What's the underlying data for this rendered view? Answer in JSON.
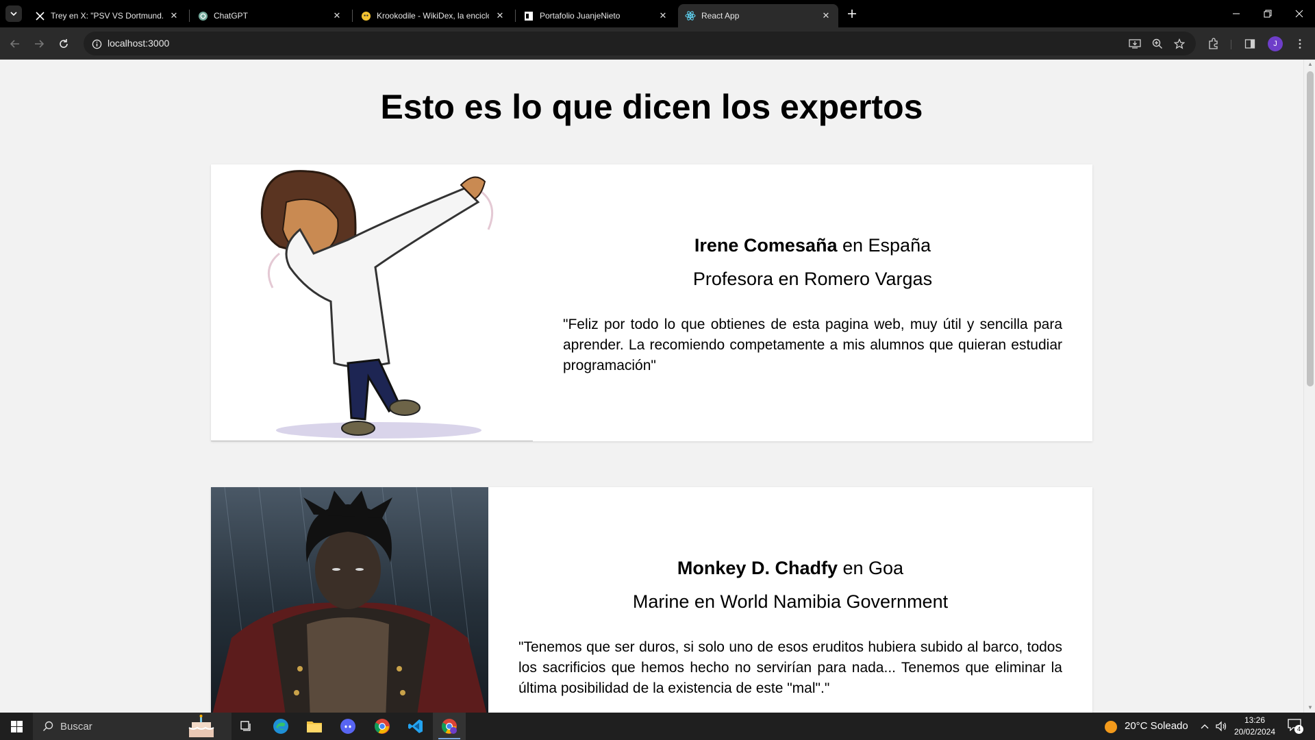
{
  "browser": {
    "tabs": [
      {
        "title": "Trey en X: \"PSV VS Dortmund. Ir",
        "icon": "x-logo-icon"
      },
      {
        "title": "ChatGPT",
        "icon": "chatgpt-icon"
      },
      {
        "title": "Krookodile - WikiDex, la enciclo",
        "icon": "wikidex-icon"
      },
      {
        "title": "Portafolio JuanjeNieto",
        "icon": "page-icon"
      },
      {
        "title": "React App",
        "icon": "react-icon"
      }
    ],
    "url": "localhost:3000"
  },
  "page": {
    "title": "Esto es lo que dicen los expertos",
    "testimonials": [
      {
        "name": "Irene Comesaña",
        "connector": " en ",
        "location": "España",
        "role": "Profesora en Romero Vargas",
        "quote": "\"Feliz por todo lo que obtienes de esta pagina web, muy útil y sencilla para aprender. La recomiendo competamente a mis alumnos que quieran estudiar programación\""
      },
      {
        "name": "Monkey D. Chadfy",
        "connector": " en ",
        "location": "Goa",
        "role": "Marine en World Namibia Government",
        "quote": "\"Tenemos que ser duros, si solo uno de esos eruditos hubiera subido al barco, todos los sacrificios que hemos hecho no servirían para nada... Tenemos que eliminar la última posibilidad de la existencia de este \"mal\".\""
      }
    ]
  },
  "taskbar": {
    "search_label": "Buscar",
    "weather": "20°C  Soleado",
    "time": "13:26",
    "date": "20/02/2024",
    "notification_count": "4"
  }
}
